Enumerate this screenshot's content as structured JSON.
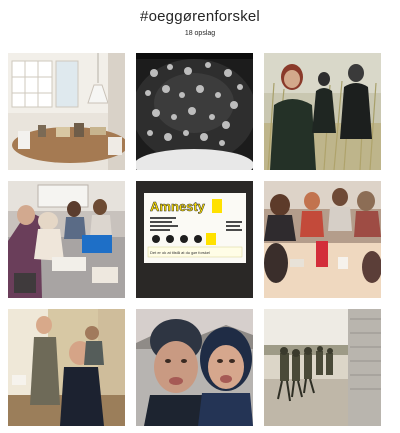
{
  "header": {
    "hashtag": "#oeggørenforskel",
    "post_count": "18 opslag"
  },
  "posts": [
    {
      "id": "post-1",
      "alt_icon": "kitchen-dining-photo"
    },
    {
      "id": "post-2",
      "alt_icon": "bw-crowd-photo"
    },
    {
      "id": "post-3",
      "alt_icon": "outdoor-reeds-photo"
    },
    {
      "id": "post-4",
      "alt_icon": "classroom-table-photo"
    },
    {
      "id": "post-5",
      "alt_icon": "amnesty-poster-photo"
    },
    {
      "id": "post-6",
      "alt_icon": "group-table-photo"
    },
    {
      "id": "post-7",
      "alt_icon": "indoor-boys-photo"
    },
    {
      "id": "post-8",
      "alt_icon": "selfie-photo"
    },
    {
      "id": "post-9",
      "alt_icon": "soldiers-photo"
    }
  ],
  "poster": {
    "title": "Amnesty",
    "line1": "Det er ok at tilstå at du gør forskel"
  },
  "colors": {
    "text": "#262626",
    "amnesty_yellow": "#ffe100"
  }
}
